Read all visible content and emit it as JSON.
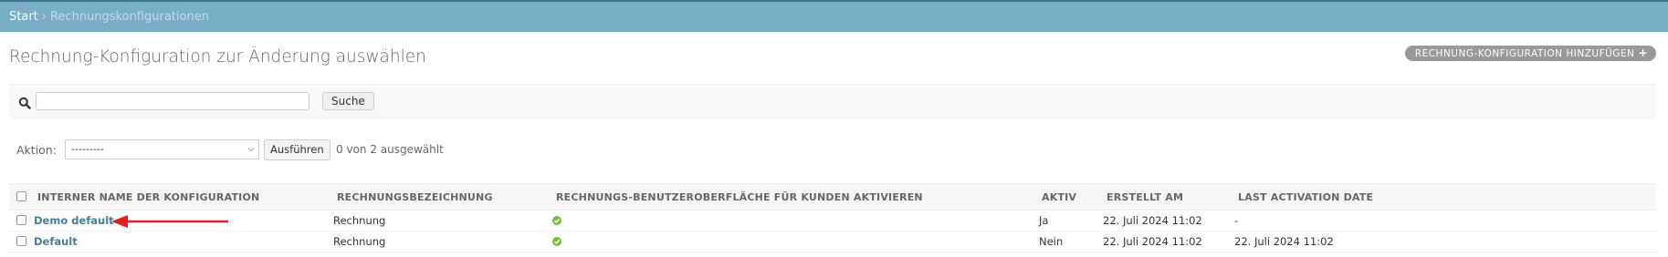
{
  "breadcrumbs": {
    "home": "Start",
    "separator": "›",
    "current": "Rechnungskonfigurationen"
  },
  "page": {
    "title": "Rechnung-Konfiguration zur Änderung auswählen",
    "add_label": "RECHNUNG-KONFIGURATION HINZUFÜGEN",
    "add_icon": "+"
  },
  "search": {
    "value": "",
    "placeholder": "",
    "button_label": "Suche"
  },
  "actions": {
    "label": "Aktion:",
    "selected": "---------",
    "go_label": "Ausführen",
    "counter": "0 von 2 ausgewählt"
  },
  "table": {
    "headers": {
      "name": "INTERNER NAME DER KONFIGURATION",
      "designation": "RECHNUNGSBEZEICHNUNG",
      "ui": "RECHNUNGS-BENUTZEROBERFLÄCHE FÜR KUNDEN AKTIVIEREN",
      "active": "AKTIV",
      "created": "ERSTELLT AM",
      "last_activation": "LAST ACTIVATION DATE"
    },
    "rows": [
      {
        "name": "Demo default",
        "designation": "Rechnung",
        "ui_enabled": true,
        "active": "Ja",
        "created": "22. Juli 2024 11:02",
        "last_activation": "-"
      },
      {
        "name": "Default",
        "designation": "Rechnung",
        "ui_enabled": true,
        "active": "Nein",
        "created": "22. Juli 2024 11:02",
        "last_activation": "22. Juli 2024 11:02"
      }
    ]
  },
  "colors": {
    "header_bar": "#79aec8",
    "link": "#447e9b",
    "ok_icon": "#70bf2b",
    "arrow": "#e02020"
  },
  "icons": {
    "search": "search-icon",
    "boolean_true": "check-circle-icon",
    "annotation": "red-arrow-icon"
  }
}
